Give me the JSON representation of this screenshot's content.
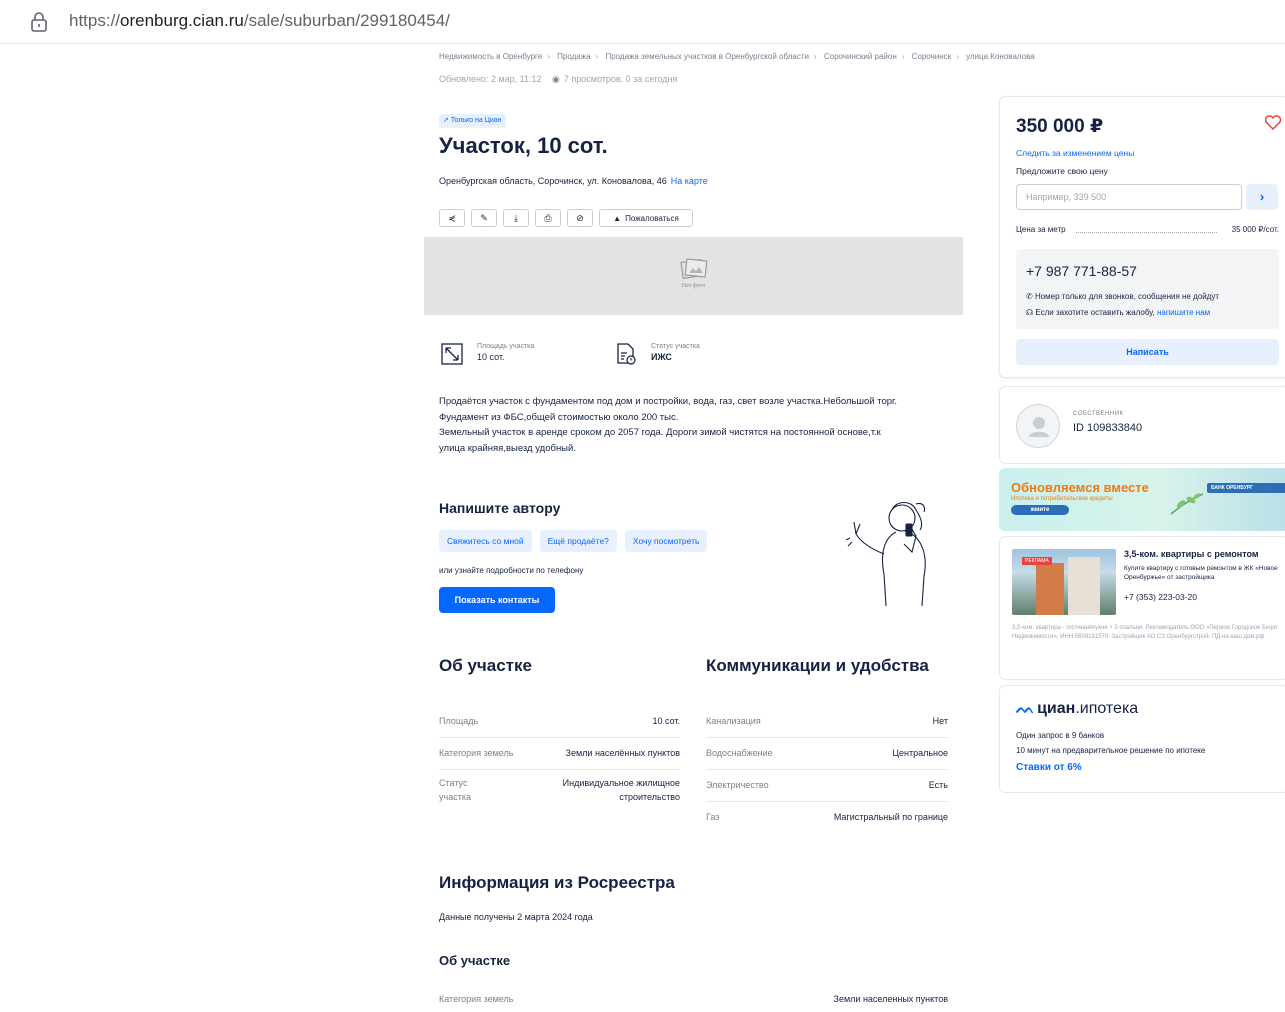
{
  "browser": {
    "url_prefix": "https://",
    "url_host": "orenburg.cian.ru",
    "url_path": "/sale/suburban/299180454/"
  },
  "breadcrumbs": [
    "Недвижимость в Оренбурге",
    "Продажа",
    "Продажа земельных участков в Оренбургской области",
    "Сорочинский район",
    "Сорочинск",
    "улица Коновалова"
  ],
  "updated": {
    "text": "Обновлено: 2 мар, 11:12",
    "views": "7 просмотров, 0 за сегодня"
  },
  "listing": {
    "badge": "Только на Циан",
    "title": "Участок, 10 сот.",
    "address": "Оренбургская область, Сорочинск, ул. Коновалова, 46",
    "map_link": "На карте",
    "complain": "Пожаловаться",
    "no_photo": "Нет фото",
    "features": [
      {
        "label": "Площадь участка",
        "value": "10 сот.",
        "icon": "area-icon"
      },
      {
        "label": "Статус участка",
        "value": "ИЖС",
        "icon": "document-status-icon"
      }
    ],
    "description": [
      "Продаётся участок с фундаментом под дом и постройки, вода, газ, свет возле участка.Небольшой торг.",
      "Фундамент из ФБС,общей стоимостью около 200 тыс.",
      "Земельный участок в аренде сроком до 2057 года. Дороги зимой чистятся на постоянной основе,т.к",
      "улица крайняя,выезд удобный."
    ]
  },
  "write_author": {
    "title": "Напишите автору",
    "chips": [
      "Свяжитесь со мной",
      "Ещё продаёте?",
      "Хочу посмотреть"
    ],
    "or_phone": "или узнайте подробности по телефону",
    "show_contacts": "Показать контакты"
  },
  "about": {
    "title": "Об участке",
    "rows": [
      {
        "k": "Площадь",
        "v": "10 сот."
      },
      {
        "k": "Категория земель",
        "v": "Земли населённых пунктов"
      },
      {
        "k": "Статус участка",
        "v": "Индивидуальное жилищное строительство"
      }
    ]
  },
  "utilities": {
    "title": "Коммуникации и удобства",
    "rows": [
      {
        "k": "Канализация",
        "v": "Нет"
      },
      {
        "k": "Водоснабжение",
        "v": "Центральное"
      },
      {
        "k": "Электричество",
        "v": "Есть"
      },
      {
        "k": "Газ",
        "v": "Магистральный по границе"
      }
    ]
  },
  "rosreestr": {
    "title": "Информация из Росреестра",
    "date": "Данные получены 2 марта 2024 года",
    "subtitle": "Об участке",
    "row_k": "Категория земель",
    "row_v": "Земли населенных пунктов"
  },
  "sidebar": {
    "price": "350 000 ₽",
    "follow": "Следить за изменением цены",
    "offer_label": "Предложите свою цену",
    "offer_placeholder": "Например, 339 500",
    "ppm_label": "Цена за метр",
    "ppm_value": "35 000 ₽/сот.",
    "phone": "+7 987 771-88-57",
    "note1": "Номер только для звонков, сообщения не дойдут",
    "note2": "Если захотите оставить жалобу,",
    "note2_link": "напишите нам",
    "write": "Написать",
    "owner_role": "СОБСТВЕННИК",
    "owner_id": "ID 109833840",
    "banner_title": "Обновляемся вместе",
    "banner_sub": "Ипотека и потребительские кредиты",
    "banner_pill": "жмите",
    "banner_bank": "БАНК ОРЕНБУРГ",
    "ad_title": "3,5-ком. квартиры с ремонтом",
    "ad_desc": "Купите квартиру с готовым ремонтом в ЖК «Новое Оренбуржье» от застройщика",
    "ad_phone": "+7 (353) 223-03-20",
    "ad_tag": "РЕКЛАМА",
    "ad_legal": "3,5-ком. квартира - гостиная/кухня + 3 спальни. Рекламодатель ООО «Первое Городское Бюро Недвижимости», ИНН 5609181578. Застройщик АО СЗ Оренбургстрой. ПД на наш.дом.рф",
    "ipoteka_brand": "циан",
    "ipoteka_word": ".ипотека",
    "ipoteka_l1": "Один запрос в 9 банков",
    "ipoteka_l2": "10 минут на предварительное решение по ипотеке",
    "ipoteka_l3": "Ставки от 6%"
  },
  "colors": {
    "accent": "#0468ff",
    "text": "#152242",
    "muted": "#7a7f8f",
    "heart": "#e8433c"
  }
}
